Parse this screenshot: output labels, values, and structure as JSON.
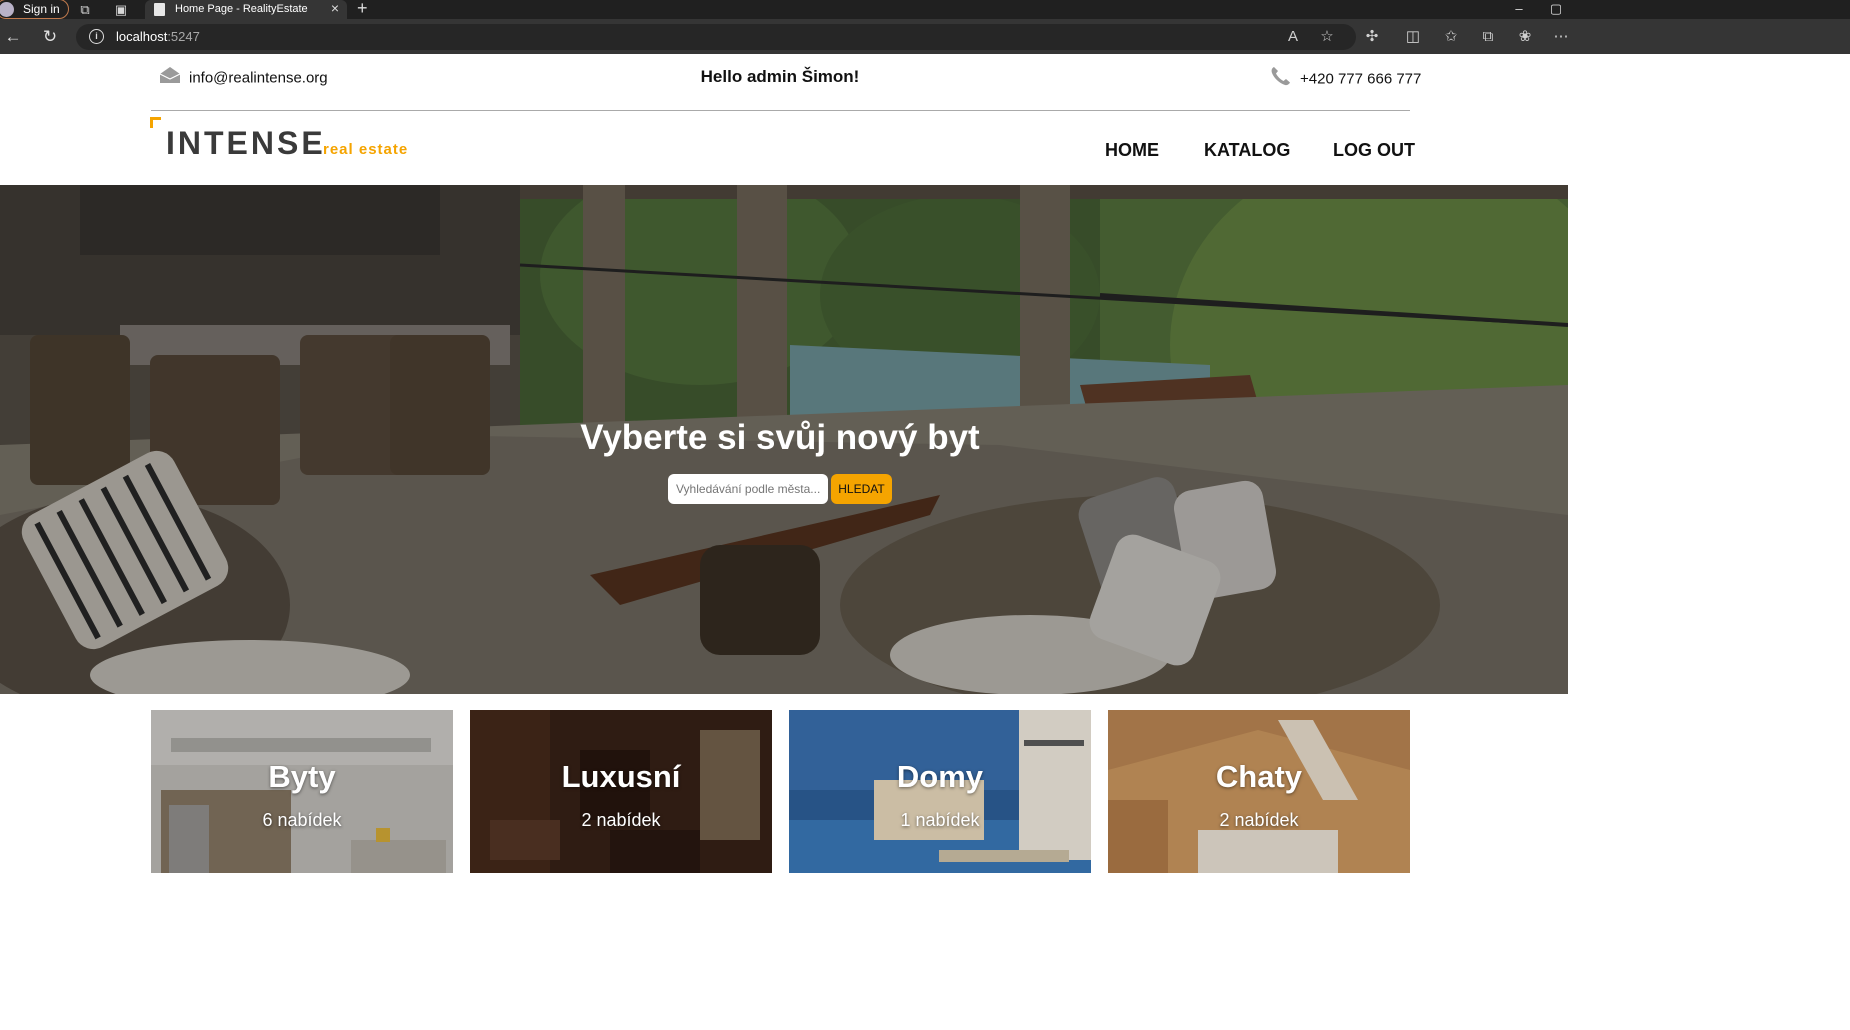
{
  "browser": {
    "sign_in_label": "Sign in",
    "tab_title": "Home Page - RealityEstate",
    "new_tab_glyph": "+",
    "close_tab_glyph": "×",
    "url_host": "localhost",
    "url_port": ":5247",
    "icons": [
      "back-icon",
      "refresh-icon",
      "site-info-icon",
      "read-aloud-icon",
      "favorite-star-icon",
      "extensions-icon",
      "split-screen-icon",
      "favorites-icon",
      "collections-icon",
      "copilot-icon",
      "more-icon"
    ]
  },
  "topbar": {
    "email": "info@realintense.org",
    "greeting": "Hello admin Šimon!",
    "phone": "+420 777 666 777"
  },
  "logo": {
    "brand": "INTENSE",
    "sub": "real estate"
  },
  "nav": {
    "items": [
      {
        "label": "HOME"
      },
      {
        "label": "KATALOG"
      },
      {
        "label": "LOG OUT"
      }
    ]
  },
  "hero": {
    "title": "Vyberte si svůj nový byt",
    "search_placeholder": "Vyhledávání podle města...",
    "search_button": "HLEDAT"
  },
  "categories": [
    {
      "title": "Byty",
      "count": "6 nabídek"
    },
    {
      "title": "Luxusní",
      "count": "2 nabídek"
    },
    {
      "title": "Domy",
      "count": "1 nabídek"
    },
    {
      "title": "Chaty",
      "count": "2 nabídek"
    }
  ],
  "colors": {
    "accent": "#f5a400",
    "chrome_dark": "#202020",
    "chrome_bar": "#353535"
  }
}
